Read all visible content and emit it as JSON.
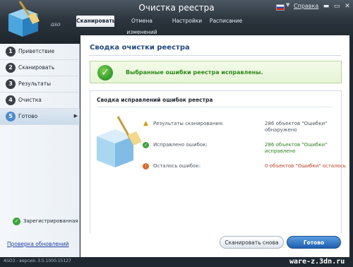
{
  "window": {
    "title": "Очистка реестра",
    "app_name": "aso",
    "help_label": "Справка",
    "min_glyph": "▬",
    "max_glyph": "▭",
    "close_glyph": "✕"
  },
  "tabs": [
    {
      "label": "Сканировать",
      "active": true
    },
    {
      "label": "Отмена изменений",
      "active": false
    },
    {
      "label": "Настройки",
      "active": false
    },
    {
      "label": "Расписание",
      "active": false
    }
  ],
  "sidebar": {
    "steps": [
      {
        "num": "1",
        "label": "Приветствие"
      },
      {
        "num": "2",
        "label": "Сканировать"
      },
      {
        "num": "3",
        "label": "Результаты"
      },
      {
        "num": "4",
        "label": "Очистка"
      },
      {
        "num": "5",
        "label": "Готово",
        "active": true
      }
    ],
    "registered_label": "Зарегистрированная",
    "update_link": "Проверка обновлений"
  },
  "main": {
    "title": "Сводка очистки реестра",
    "success_message": "Выбранные ошибки реестра исправлены.",
    "summary_title": "Сводка исправлений ошибок реестра",
    "rows": [
      {
        "icon": "warning-icon",
        "label": "Результаты сканирования:",
        "value": "286 объектов \"Ошибки\" обнаружено",
        "tone": "neutral"
      },
      {
        "icon": "check-icon",
        "label": "Исправлено ошибок:",
        "value": "286 объектов \"Ошибки\" исправлено",
        "tone": "green"
      },
      {
        "icon": "error-icon",
        "label": "Осталось ошибок:",
        "value": "0 объектов \"Ошибки\" осталось",
        "tone": "red"
      }
    ]
  },
  "buttons": {
    "rescan_label": "Сканировать снова",
    "done_label": "Готово"
  },
  "status": {
    "version": "ASO3 - версия: 3.5.1000.15127",
    "watermark": "ware-z.3dn.ru"
  },
  "colors": {
    "accent": "#1f5fae",
    "success": "#2c8a1a",
    "error": "#d23b1e"
  }
}
